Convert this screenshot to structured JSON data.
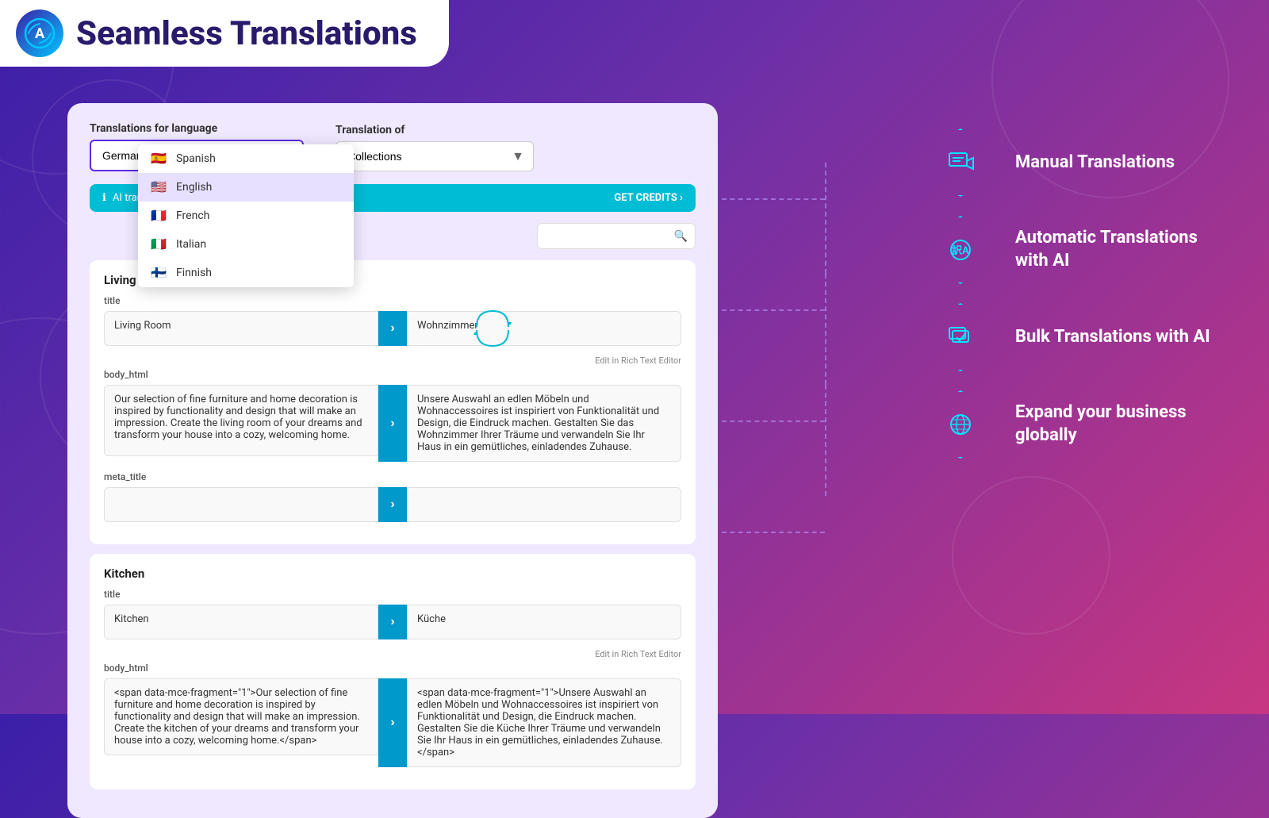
{
  "header": {
    "title": "Seamless Translations",
    "logo_letter": "A"
  },
  "card": {
    "translations_for_label": "Translations for language",
    "translation_of_label": "Translation of",
    "selected_language": "German",
    "selected_collection": "Collections",
    "ai_bar_text": "AI translation credits",
    "get_credits_label": "GET CREDITS ›",
    "search_placeholder": "",
    "dropdown": {
      "items": [
        {
          "label": "Spanish",
          "flag": "🇪🇸"
        },
        {
          "label": "English",
          "flag": "🇺🇸"
        },
        {
          "label": "French",
          "flag": "🇫🇷"
        },
        {
          "label": "Italian",
          "flag": "🇮🇹"
        },
        {
          "label": "Finnish",
          "flag": "🇫🇮"
        }
      ]
    },
    "items": [
      {
        "section": "Living Room",
        "title_label": "title",
        "title_source": "Living Room",
        "title_target": "Wohnzimmer",
        "body_label": "body_html",
        "body_source": "Our selection of fine furniture and home decoration is inspired by functionality and design that will make an impression. Create the living room of your dreams and transform your house into a cozy, welcoming home.",
        "body_target": "Unsere Auswahl an edlen Möbeln und Wohnaccessoires ist inspiriert von Funktionalität und Design, die Eindruck machen. Gestalten Sie das Wohnzimmer Ihrer Träume und verwandeln Sie Ihr Haus in ein gemütliches, einladendes Zuhause.",
        "rich_text_link": "Edit in Rich Text Editor",
        "meta_title_label": "meta_title",
        "meta_title_source": "",
        "meta_title_target": ""
      },
      {
        "section": "Kitchen",
        "title_label": "title",
        "title_source": "Kitchen",
        "title_target": "Küche",
        "body_label": "body_html",
        "body_source": "<span data-mce-fragment=\"1\">Our selection of fine furniture and home decoration is inspired by functionality and design that will make an impression. Create the kitchen of your dreams and transform your house into a cozy, welcoming home.</span>",
        "body_target": "<span data-mce-fragment=\"1\">Unsere Auswahl an edlen Möbeln und Wohnaccessoires ist inspiriert von Funktionalität und Design, die Eindruck machen. Gestalten Sie die Küche Ihrer Träume und verwandeln Sie Ihr Haus in ein gemütliches, einladendes Zuhause.</span>",
        "rich_text_link": "Edit in Rich Text Editor"
      }
    ]
  },
  "features": [
    {
      "label": "Manual Translations",
      "icon": "✈",
      "icon_name": "manual-translation-icon"
    },
    {
      "label": "Automatic Translations with AI",
      "icon": "🧠",
      "icon_name": "ai-translation-icon"
    },
    {
      "label": "Bulk Translations with AI",
      "icon": "✓",
      "icon_name": "bulk-translation-icon"
    },
    {
      "label": "Expand your business globally",
      "icon": "🌐",
      "icon_name": "global-icon"
    }
  ]
}
